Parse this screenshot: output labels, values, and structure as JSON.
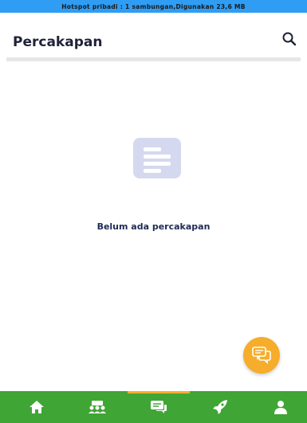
{
  "status_bar": {
    "text": "Hotspot pribadi : 1 sambungan,Digunakan 23,6 MB"
  },
  "header": {
    "title": "Percakapan",
    "search_icon": "search-icon"
  },
  "empty_state": {
    "icon": "document-lines-icon",
    "message": "Belum ada percakapan"
  },
  "fab": {
    "icon": "chat-bubbles-icon"
  },
  "bottom_nav": {
    "items": [
      {
        "icon": "home-icon",
        "active": false
      },
      {
        "icon": "group-icon",
        "active": false
      },
      {
        "icon": "messages-icon",
        "active": true
      },
      {
        "icon": "rocket-icon",
        "active": false
      },
      {
        "icon": "profile-icon",
        "active": false
      }
    ]
  },
  "colors": {
    "status_bar": "#2f9df4",
    "nav_bar": "#3fa535",
    "accent": "#f5ad2b",
    "title": "#1f2238",
    "empty_icon": "#d5d9ef"
  }
}
